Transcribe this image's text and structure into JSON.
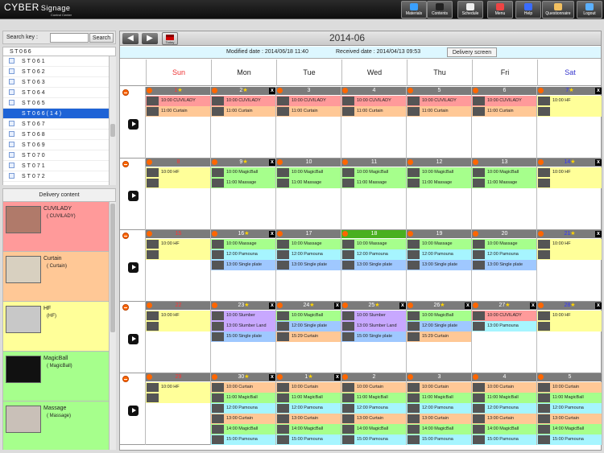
{
  "app": {
    "brand": "CYBER",
    "brand_suffix": "Signage",
    "subtitle": "Control Center"
  },
  "nav": [
    {
      "label": "Materials",
      "color": "#3aa0ff"
    },
    {
      "label": "Contents",
      "color": "#222"
    },
    {
      "label": "Schedule",
      "color": "#eee"
    },
    {
      "label": "Menu",
      "color": "#e44"
    },
    {
      "label": "Help",
      "color": "#3a6cff"
    },
    {
      "label": "Questionnaire",
      "color": "#f2c060"
    },
    {
      "label": "Logout",
      "color": "#5ab0ff"
    }
  ],
  "search": {
    "label": "Search key :",
    "value": "",
    "button": "Search"
  },
  "tree": {
    "root": "ST066",
    "items": [
      {
        "label": "ST061",
        "selected": false
      },
      {
        "label": "ST062",
        "selected": false
      },
      {
        "label": "ST063",
        "selected": false
      },
      {
        "label": "ST064",
        "selected": false
      },
      {
        "label": "ST065",
        "selected": false
      },
      {
        "label": "ST066(14)",
        "selected": true
      },
      {
        "label": "ST067",
        "selected": false
      },
      {
        "label": "ST068",
        "selected": false
      },
      {
        "label": "ST069",
        "selected": false
      },
      {
        "label": "ST070",
        "selected": false
      },
      {
        "label": "ST071",
        "selected": false
      },
      {
        "label": "ST072",
        "selected": false
      }
    ]
  },
  "delivery": {
    "title": "Delivery content",
    "items": [
      {
        "name": "CUVILADY",
        "sub": "( CUVILADY)",
        "color": "#ff9a9a"
      },
      {
        "name": "Curtain",
        "sub": "( Curtain)",
        "color": "#ffc896"
      },
      {
        "name": "HF",
        "sub": "(HF)",
        "color": "#ffff99"
      },
      {
        "name": "MagicBall",
        "sub": "( MagicBall)",
        "color": "#a6ff8c"
      },
      {
        "name": "Massage",
        "sub": "( Massage)",
        "color": "#a6ff8c"
      }
    ]
  },
  "calendar": {
    "prev": "◀",
    "next": "▶",
    "today": "Today",
    "month": "2014-06",
    "modified": "Modified date : 2014/06/18 11:40",
    "received": "Received date : 2014/04/13 09:53",
    "delivery_button": "Delivery screen",
    "dow": [
      "Sun",
      "Mon",
      "Tue",
      "Wed",
      "Thu",
      "Fri",
      "Sat"
    ],
    "colors": {
      "pink": "#ff9a9a",
      "orange": "#ffc896",
      "yellow": "#ffff99",
      "green": "#a6ff8c",
      "cyan": "#a6f5ff",
      "blue": "#9fc8ff",
      "violet": "#c8a8ff"
    },
    "weeks": [
      [
        {
          "num": "1",
          "star": "★",
          "numclass": "red",
          "x": "",
          "events": [
            {
              "t": "10:00 CUVILADY",
              "c": "pink"
            },
            {
              "t": "11:00 Curtain",
              "c": "orange"
            }
          ]
        },
        {
          "num": "2",
          "star": "★",
          "numclass": "",
          "x": "x",
          "events": [
            {
              "t": "10:00 CUVILADY",
              "c": "pink"
            },
            {
              "t": "11:00 Curtain",
              "c": "orange"
            }
          ]
        },
        {
          "num": "3",
          "star": "",
          "numclass": "",
          "x": "",
          "events": [
            {
              "t": "10:00 CUVILADY",
              "c": "pink"
            },
            {
              "t": "11:00 Curtain",
              "c": "orange"
            }
          ]
        },
        {
          "num": "4",
          "star": "",
          "numclass": "",
          "x": "",
          "events": [
            {
              "t": "10:00 CUVILADY",
              "c": "pink"
            },
            {
              "t": "11:00 Curtain",
              "c": "orange"
            }
          ]
        },
        {
          "num": "5",
          "star": "",
          "numclass": "",
          "x": "",
          "events": [
            {
              "t": "10:00 CUVILADY",
              "c": "pink"
            },
            {
              "t": "11:00 Curtain",
              "c": "orange"
            }
          ]
        },
        {
          "num": "6",
          "star": "",
          "numclass": "",
          "x": "",
          "events": [
            {
              "t": "10:00 CUVILADY",
              "c": "pink"
            },
            {
              "t": "11:00 Curtain",
              "c": "orange"
            }
          ]
        },
        {
          "num": "7",
          "star": "★",
          "numclass": "blue",
          "x": "x",
          "events": [
            {
              "t": "10:00 HF",
              "c": "yellow"
            },
            {
              "t": "",
              "c": "yellow"
            }
          ]
        }
      ],
      [
        {
          "num": "8",
          "star": "",
          "numclass": "red",
          "x": "",
          "events": [
            {
              "t": "10:00 HF",
              "c": "yellow"
            },
            {
              "t": "",
              "c": "yellow"
            }
          ]
        },
        {
          "num": "9",
          "star": "★",
          "numclass": "",
          "x": "x",
          "events": [
            {
              "t": "10:00 MagicBall",
              "c": "green"
            },
            {
              "t": "11:00 Massage",
              "c": "green"
            }
          ]
        },
        {
          "num": "10",
          "star": "",
          "numclass": "",
          "x": "",
          "events": [
            {
              "t": "10:00 MagicBall",
              "c": "green"
            },
            {
              "t": "11:00 Massage",
              "c": "green"
            }
          ]
        },
        {
          "num": "11",
          "star": "",
          "numclass": "",
          "x": "",
          "events": [
            {
              "t": "10:00 MagicBall",
              "c": "green"
            },
            {
              "t": "11:00 Massage",
              "c": "green"
            }
          ]
        },
        {
          "num": "12",
          "star": "",
          "numclass": "",
          "x": "",
          "events": [
            {
              "t": "10:00 MagicBall",
              "c": "green"
            },
            {
              "t": "11:00 Massage",
              "c": "green"
            }
          ]
        },
        {
          "num": "13",
          "star": "",
          "numclass": "",
          "x": "",
          "events": [
            {
              "t": "10:00 MagicBall",
              "c": "green"
            },
            {
              "t": "11:00 Massage",
              "c": "green"
            }
          ]
        },
        {
          "num": "14",
          "star": "★",
          "numclass": "blue",
          "x": "x",
          "events": [
            {
              "t": "10:00 HF",
              "c": "yellow"
            },
            {
              "t": "",
              "c": "yellow"
            }
          ]
        }
      ],
      [
        {
          "num": "15",
          "star": "",
          "numclass": "red",
          "x": "",
          "events": [
            {
              "t": "10:00 HF",
              "c": "yellow"
            },
            {
              "t": "",
              "c": "yellow"
            }
          ]
        },
        {
          "num": "16",
          "star": "★",
          "numclass": "",
          "x": "x",
          "events": [
            {
              "t": "10:00 Massage",
              "c": "green"
            },
            {
              "t": "12:00 Pamouna",
              "c": "cyan"
            },
            {
              "t": "13:00 Single plate",
              "c": "blue"
            }
          ]
        },
        {
          "num": "17",
          "star": "",
          "numclass": "",
          "x": "",
          "events": [
            {
              "t": "10:00 Massage",
              "c": "green"
            },
            {
              "t": "12:00 Pamouna",
              "c": "cyan"
            },
            {
              "t": "13:00 Single plate",
              "c": "blue"
            }
          ]
        },
        {
          "num": "18",
          "star": "",
          "numclass": "",
          "x": "",
          "today": true,
          "events": [
            {
              "t": "10:00 Massage",
              "c": "green"
            },
            {
              "t": "12:00 Pamouna",
              "c": "cyan"
            },
            {
              "t": "13:00 Single plate",
              "c": "blue"
            }
          ]
        },
        {
          "num": "19",
          "star": "",
          "numclass": "",
          "x": "",
          "events": [
            {
              "t": "10:00 Massage",
              "c": "green"
            },
            {
              "t": "12:00 Pamouna",
              "c": "cyan"
            },
            {
              "t": "13:00 Single plate",
              "c": "blue"
            }
          ]
        },
        {
          "num": "20",
          "star": "",
          "numclass": "",
          "x": "",
          "events": [
            {
              "t": "10:00 Massage",
              "c": "green"
            },
            {
              "t": "12:00 Pamouna",
              "c": "cyan"
            },
            {
              "t": "13:00 Single plate",
              "c": "blue"
            }
          ]
        },
        {
          "num": "21",
          "star": "★",
          "numclass": "blue",
          "x": "x",
          "events": [
            {
              "t": "10:00 HF",
              "c": "yellow"
            },
            {
              "t": "",
              "c": "yellow"
            }
          ]
        }
      ],
      [
        {
          "num": "22",
          "star": "",
          "numclass": "red",
          "x": "",
          "events": [
            {
              "t": "10:00 HF",
              "c": "yellow"
            },
            {
              "t": "",
              "c": "yellow"
            }
          ]
        },
        {
          "num": "23",
          "star": "★",
          "numclass": "",
          "x": "x",
          "events": [
            {
              "t": "10:00 Slumber",
              "c": "violet"
            },
            {
              "t": "13:00 Slumber Land",
              "c": "violet"
            },
            {
              "t": "15:00 Single plate",
              "c": "blue"
            }
          ]
        },
        {
          "num": "24",
          "star": "★",
          "numclass": "",
          "x": "x",
          "events": [
            {
              "t": "10:00 MagicBall",
              "c": "green"
            },
            {
              "t": "12:00 Single plate",
              "c": "blue"
            },
            {
              "t": "15:29 Curtain",
              "c": "orange"
            }
          ]
        },
        {
          "num": "25",
          "star": "★",
          "numclass": "",
          "x": "x",
          "events": [
            {
              "t": "10:00 Slumber",
              "c": "violet"
            },
            {
              "t": "13:00 Slumber Land",
              "c": "violet"
            },
            {
              "t": "15:00 Single plate",
              "c": "blue"
            }
          ]
        },
        {
          "num": "26",
          "star": "★",
          "numclass": "",
          "x": "x",
          "events": [
            {
              "t": "10:00 MagicBall",
              "c": "green"
            },
            {
              "t": "12:00 Single plate",
              "c": "blue"
            },
            {
              "t": "15:29 Curtain",
              "c": "orange"
            }
          ]
        },
        {
          "num": "27",
          "star": "★",
          "numclass": "",
          "x": "x",
          "events": [
            {
              "t": "10:00 CUVILADY",
              "c": "pink"
            },
            {
              "t": "13:00 Pamouna",
              "c": "cyan"
            }
          ]
        },
        {
          "num": "28",
          "star": "★",
          "numclass": "blue",
          "x": "x",
          "events": [
            {
              "t": "10:00 HF",
              "c": "yellow"
            },
            {
              "t": "",
              "c": "yellow"
            }
          ]
        }
      ],
      [
        {
          "num": "29",
          "star": "",
          "numclass": "red",
          "x": "",
          "events": [
            {
              "t": "10:00 HF",
              "c": "yellow"
            },
            {
              "t": "",
              "c": "yellow"
            }
          ]
        },
        {
          "num": "30",
          "star": "★",
          "numclass": "",
          "x": "x",
          "events": [
            {
              "t": "10:00 Curtain",
              "c": "orange"
            },
            {
              "t": "11:00 MagicBall",
              "c": "green"
            },
            {
              "t": "12:00 Pamouna",
              "c": "cyan"
            },
            {
              "t": "13:00 Curtain",
              "c": "orange"
            },
            {
              "t": "14:00 MagicBall",
              "c": "green"
            },
            {
              "t": "15:00 Pamouna",
              "c": "cyan"
            }
          ]
        },
        {
          "num": "1",
          "star": "★",
          "numclass": "",
          "x": "x",
          "events": [
            {
              "t": "10:00 Curtain",
              "c": "orange"
            },
            {
              "t": "11:00 MagicBall",
              "c": "green"
            },
            {
              "t": "12:00 Pamouna",
              "c": "cyan"
            },
            {
              "t": "13:00 Curtain",
              "c": "orange"
            },
            {
              "t": "14:00 MagicBall",
              "c": "green"
            },
            {
              "t": "15:00 Pamouna",
              "c": "cyan"
            }
          ]
        },
        {
          "num": "2",
          "star": "",
          "numclass": "",
          "x": "",
          "events": [
            {
              "t": "10:00 Curtain",
              "c": "orange"
            },
            {
              "t": "11:00 MagicBall",
              "c": "green"
            },
            {
              "t": "12:00 Pamouna",
              "c": "cyan"
            },
            {
              "t": "13:00 Curtain",
              "c": "orange"
            },
            {
              "t": "14:00 MagicBall",
              "c": "green"
            },
            {
              "t": "15:00 Pamouna",
              "c": "cyan"
            }
          ]
        },
        {
          "num": "3",
          "star": "",
          "numclass": "",
          "x": "",
          "events": [
            {
              "t": "10:00 Curtain",
              "c": "orange"
            },
            {
              "t": "11:00 MagicBall",
              "c": "green"
            },
            {
              "t": "12:00 Pamouna",
              "c": "cyan"
            },
            {
              "t": "13:00 Curtain",
              "c": "orange"
            },
            {
              "t": "14:00 MagicBall",
              "c": "green"
            },
            {
              "t": "15:00 Pamouna",
              "c": "cyan"
            }
          ]
        },
        {
          "num": "4",
          "star": "",
          "numclass": "",
          "x": "",
          "events": [
            {
              "t": "10:00 Curtain",
              "c": "orange"
            },
            {
              "t": "11:00 MagicBall",
              "c": "green"
            },
            {
              "t": "12:00 Pamouna",
              "c": "cyan"
            },
            {
              "t": "13:00 Curtain",
              "c": "orange"
            },
            {
              "t": "14:00 MagicBall",
              "c": "green"
            },
            {
              "t": "15:00 Pamouna",
              "c": "cyan"
            }
          ]
        },
        {
          "num": "5",
          "star": "",
          "numclass": "",
          "x": "",
          "events": [
            {
              "t": "10:00 Curtain",
              "c": "orange"
            },
            {
              "t": "11:00 MagicBall",
              "c": "green"
            },
            {
              "t": "12:00 Pamouna",
              "c": "cyan"
            },
            {
              "t": "13:00 Curtain",
              "c": "orange"
            },
            {
              "t": "14:00 MagicBall",
              "c": "green"
            },
            {
              "t": "15:00 Pamouna",
              "c": "cyan"
            }
          ]
        }
      ]
    ]
  }
}
